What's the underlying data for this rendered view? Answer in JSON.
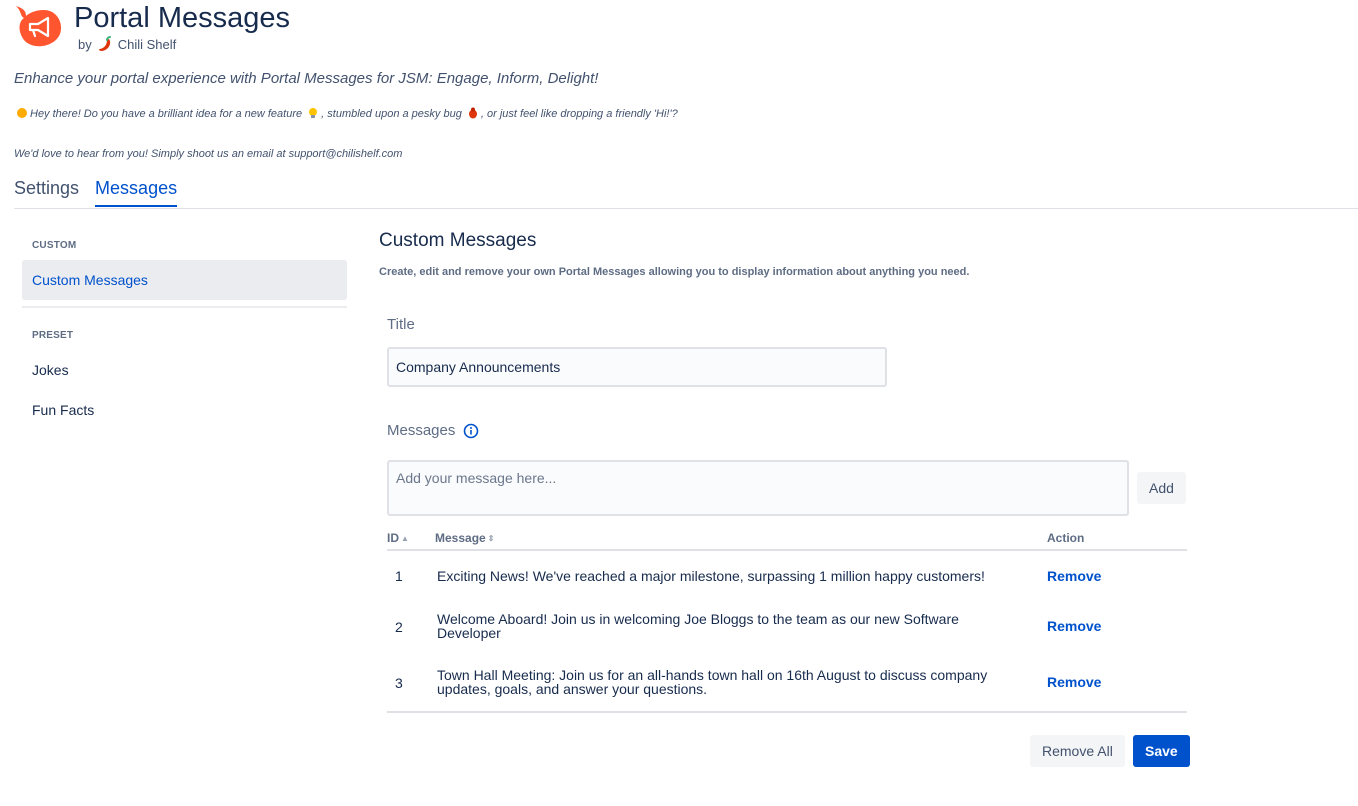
{
  "app": {
    "title": "Portal Messages",
    "by": "by",
    "vendor": "Chili Shelf",
    "tagline": "Enhance your portal experience with Portal Messages for JSM: Engage, Inform, Delight!",
    "hey_part1": "Hey there! Do you have a brilliant idea for a new feature",
    "hey_part2": ", stumbled upon a pesky bug",
    "hey_part3": ", or just feel like dropping a friendly 'Hi!'?",
    "contact": "We'd love to hear from you! Simply shoot us an email at support@chilishelf.com"
  },
  "tabs": [
    {
      "label": "Settings"
    },
    {
      "label": "Messages"
    }
  ],
  "sidebar": {
    "custom_heading": "CUSTOM",
    "custom_items": [
      {
        "label": "Custom Messages"
      }
    ],
    "preset_heading": "PRESET",
    "preset_items": [
      {
        "label": "Jokes"
      },
      {
        "label": "Fun Facts"
      }
    ]
  },
  "main": {
    "title": "Custom Messages",
    "description": "Create, edit and remove your own Portal Messages allowing you to display information about anything you need.",
    "title_label": "Title",
    "title_value": "Company Announcements",
    "messages_label": "Messages",
    "message_placeholder": "Add your message here...",
    "add_label": "Add",
    "table": {
      "headers": {
        "id": "ID",
        "message": "Message",
        "action": "Action"
      },
      "rows": [
        {
          "id": "1",
          "message": "Exciting News! We've reached a major milestone, surpassing 1 million happy customers!",
          "action": "Remove"
        },
        {
          "id": "2",
          "message": "Welcome Aboard! Join us in welcoming Joe Bloggs to the team as our new Software Developer",
          "action": "Remove"
        },
        {
          "id": "3",
          "message": "Town Hall Meeting: Join us for an all-hands town hall on 16th August to discuss company updates, goals, and answer your questions.",
          "action": "Remove"
        }
      ]
    },
    "remove_all_label": "Remove All",
    "save_label": "Save"
  },
  "colors": {
    "accent": "#0052cc",
    "logo": "#ff5630"
  }
}
